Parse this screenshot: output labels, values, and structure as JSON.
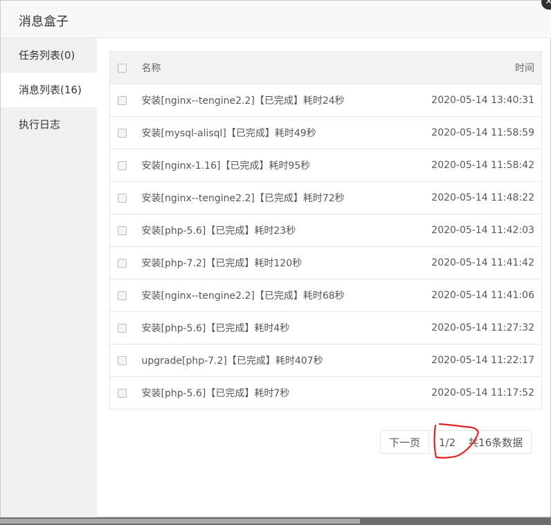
{
  "dialog": {
    "title": "消息盒子",
    "close_icon": "close-icon"
  },
  "sidebar": {
    "items": [
      {
        "label": "任务列表(0)",
        "active": false
      },
      {
        "label": "消息列表(16)",
        "active": true
      },
      {
        "label": "执行日志",
        "active": false
      }
    ]
  },
  "table": {
    "headers": {
      "name": "名称",
      "time": "时间"
    },
    "rows": [
      {
        "name": "安装[nginx--tengine2.2]【已完成】耗时24秒",
        "time": "2020-05-14 13:40:31"
      },
      {
        "name": "安装[mysql-alisql]【已完成】耗时49秒",
        "time": "2020-05-14 11:58:59"
      },
      {
        "name": "安装[nginx-1.16]【已完成】耗时95秒",
        "time": "2020-05-14 11:58:42"
      },
      {
        "name": "安装[nginx--tengine2.2]【已完成】耗时72秒",
        "time": "2020-05-14 11:48:22"
      },
      {
        "name": "安装[php-5.6]【已完成】耗时23秒",
        "time": "2020-05-14 11:42:03"
      },
      {
        "name": "安装[php-7.2]【已完成】耗时120秒",
        "time": "2020-05-14 11:41:42"
      },
      {
        "name": "安装[nginx--tengine2.2]【已完成】耗时68秒",
        "time": "2020-05-14 11:41:06"
      },
      {
        "name": "安装[php-5.6]【已完成】耗时4秒",
        "time": "2020-05-14 11:27:32"
      },
      {
        "name": "upgrade[php-7.2]【已完成】耗时407秒",
        "time": "2020-05-14 11:22:17"
      },
      {
        "name": "安装[php-5.6]【已完成】耗时7秒",
        "time": "2020-05-14 11:17:52"
      }
    ]
  },
  "pager": {
    "next_label": "下一页",
    "current": "1/2",
    "total": "共16条数据"
  },
  "colors": {
    "annotation": "#e8211e",
    "sidebar_bg": "#f0f0f0",
    "header_bg": "#f2f2f2"
  }
}
